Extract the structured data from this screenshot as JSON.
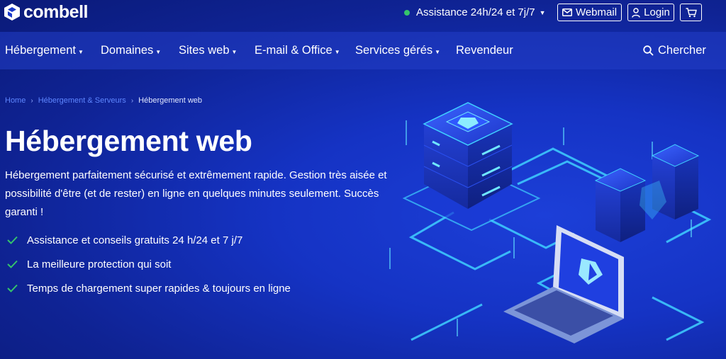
{
  "brand": {
    "name": "combell"
  },
  "topbar": {
    "support_label": "Assistance 24h/24 et 7j/7",
    "webmail_label": "Webmail",
    "login_label": "Login"
  },
  "nav": {
    "items": [
      {
        "label": "Hébergement"
      },
      {
        "label": "Domaines"
      },
      {
        "label": "Sites web"
      },
      {
        "label": "E-mail & Office"
      },
      {
        "label": "Services gérés"
      },
      {
        "label": "Revendeur"
      }
    ],
    "search_label": "Chercher"
  },
  "breadcrumb": {
    "items": [
      {
        "label": "Home"
      },
      {
        "label": "Hébergement & Serveurs"
      },
      {
        "label": "Hébergement web"
      }
    ]
  },
  "hero": {
    "title": "Hébergement web",
    "description": "Hébergement parfaitement sécurisé et extrêmement rapide. Gestion très aisée et possibilité d'être (et de rester) en ligne en quelques minutes seulement. Succès garanti !",
    "features": [
      "Assistance et conseils gratuits 24 h/24 et 7 j/7",
      "La meilleure protection qui soit",
      "Temps de chargement super rapides & toujours en ligne"
    ]
  },
  "colors": {
    "background": "#1533c4",
    "online_dot": "#35c46b",
    "check": "#35c46b",
    "breadcrumb_link": "#5e86ff",
    "glow": "#3fd0ff"
  }
}
